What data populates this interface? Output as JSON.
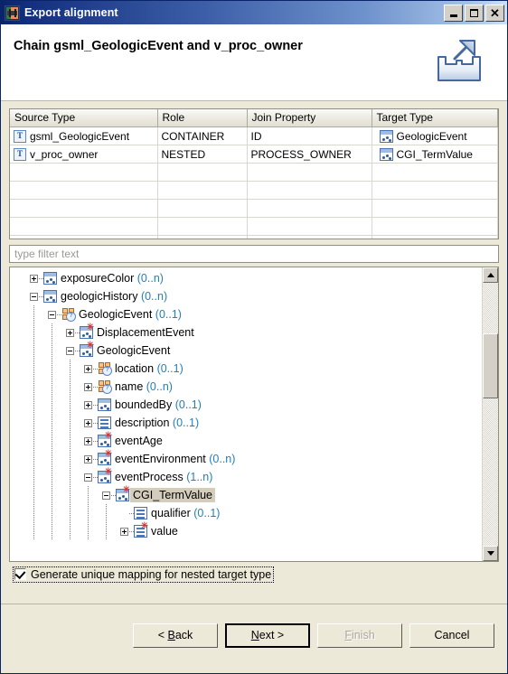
{
  "window": {
    "title": "Export alignment",
    "app_icon": "export-app-icon",
    "controls": {
      "minimize": "minimize-button",
      "maximize": "maximize-button",
      "close": "close-button"
    }
  },
  "header": {
    "title": "Chain gsml_GeologicEvent and v_proc_owner",
    "icon": "export-arrow-icon"
  },
  "table": {
    "columns": [
      "Source Type",
      "Role",
      "Join Property",
      "Target Type"
    ],
    "rows": [
      {
        "source_type": "gsml_GeologicEvent",
        "source_icon": "table-type-icon",
        "role": "CONTAINER",
        "join_property": "ID",
        "target_type": "GeologicEvent",
        "target_icon": "class-type-icon"
      },
      {
        "source_type": "v_proc_owner",
        "source_icon": "table-type-icon",
        "role": "NESTED",
        "join_property": "PROCESS_OWNER",
        "target_type": "CGI_TermValue",
        "target_icon": "class-type-icon"
      }
    ],
    "empty_rows": 6
  },
  "filter": {
    "placeholder": "type filter text",
    "value": ""
  },
  "tree": {
    "nodes": [
      {
        "depth": 1,
        "twisty": "plus",
        "icon": "class-type-icon",
        "label": "exposureColor",
        "cardinality": "(0..n)",
        "selected": false
      },
      {
        "depth": 1,
        "twisty": "minus",
        "icon": "class-type-icon",
        "label": "geologicHistory",
        "cardinality": "(0..n)",
        "selected": false
      },
      {
        "depth": 2,
        "twisty": "minus",
        "icon": "grid-type-icon",
        "label": "GeologicEvent",
        "cardinality": "(0..1)",
        "selected": false
      },
      {
        "depth": 3,
        "twisty": "plus",
        "icon": "class-star-icon",
        "label": "DisplacementEvent",
        "cardinality": "",
        "selected": false
      },
      {
        "depth": 3,
        "twisty": "minus",
        "icon": "class-star-icon",
        "label": "GeologicEvent",
        "cardinality": "",
        "selected": false
      },
      {
        "depth": 4,
        "twisty": "plus",
        "icon": "grid-type-icon",
        "label": "location",
        "cardinality": "(0..1)",
        "selected": false
      },
      {
        "depth": 4,
        "twisty": "plus",
        "icon": "grid-type-icon",
        "label": "name",
        "cardinality": "(0..n)",
        "selected": false
      },
      {
        "depth": 4,
        "twisty": "plus",
        "icon": "class-type-icon",
        "label": "boundedBy",
        "cardinality": "(0..1)",
        "selected": false
      },
      {
        "depth": 4,
        "twisty": "plus",
        "icon": "property-icon",
        "label": "description",
        "cardinality": "(0..1)",
        "selected": false
      },
      {
        "depth": 4,
        "twisty": "plus",
        "icon": "class-star-icon",
        "label": "eventAge",
        "cardinality": "",
        "selected": false
      },
      {
        "depth": 4,
        "twisty": "plus",
        "icon": "class-star-icon",
        "label": "eventEnvironment",
        "cardinality": "(0..n)",
        "selected": false
      },
      {
        "depth": 4,
        "twisty": "minus",
        "icon": "class-star-icon",
        "label": "eventProcess",
        "cardinality": "(1..n)",
        "selected": false
      },
      {
        "depth": 5,
        "twisty": "minus",
        "icon": "class-star-icon",
        "label": "CGI_TermValue",
        "cardinality": "",
        "selected": true
      },
      {
        "depth": 6,
        "twisty": "none",
        "icon": "property-icon",
        "label": "qualifier",
        "cardinality": "(0..1)",
        "selected": false
      },
      {
        "depth": 6,
        "twisty": "plus",
        "icon": "property-star-icon",
        "label": "value",
        "cardinality": "",
        "selected": false
      }
    ],
    "scrollbar": {
      "up": "scroll-up-arrow",
      "down": "scroll-down-arrow"
    }
  },
  "checkbox": {
    "label": "Generate unique mapping for nested target type",
    "checked": true
  },
  "buttons": {
    "back": "< Back",
    "next": "Next >",
    "finish": "Finish",
    "cancel": "Cancel",
    "finish_disabled": true,
    "default": "next"
  },
  "colors": {
    "titlebar_start": "#0a246a",
    "titlebar_end": "#cfe0f5",
    "dialog_bg": "#ece9d8",
    "cardinality": "#1f7fbf",
    "selection": "#d4cdbc"
  }
}
